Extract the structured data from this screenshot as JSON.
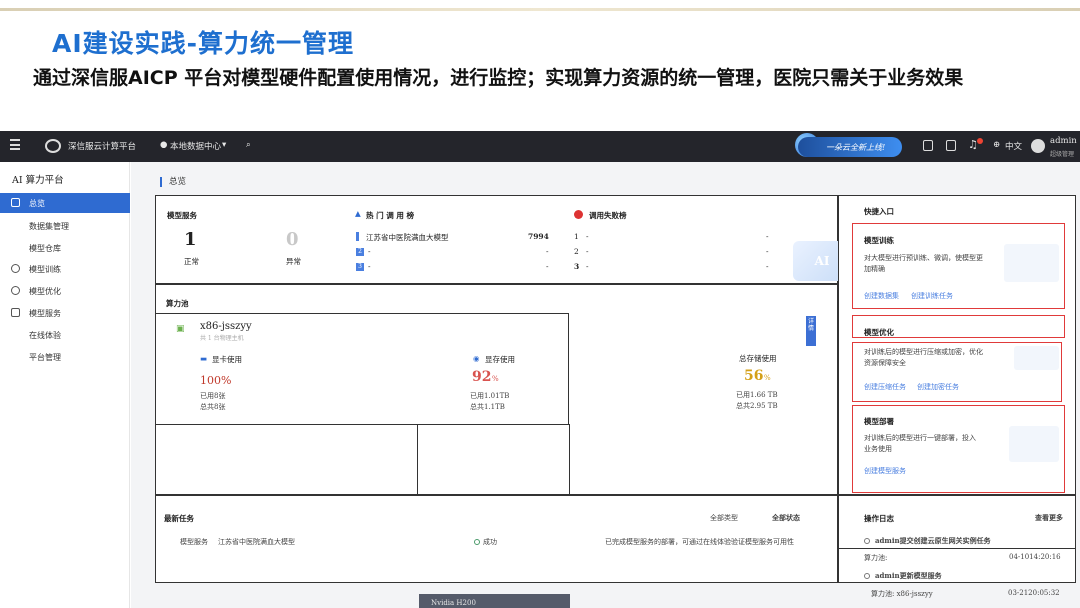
{
  "slide": {
    "title": "AI建设实践-算力统一管理",
    "description": "通过深信服AICP 平台对模型硬件配置使用情况，进行监控；实现算力资源的统一管理，医院只需关于业务效果"
  },
  "topbar": {
    "app_name": "深信服云计算平台",
    "datacenter": "本地数据中心",
    "banner_text": "一朵云全新上线!",
    "language": "中文",
    "user": "admin",
    "user_sub": "超级管理"
  },
  "sidebar": {
    "title": "AI 算力平台",
    "items": [
      {
        "label": "总览",
        "icon": "dashboard-icon"
      },
      {
        "label": "数据集管理",
        "icon": ""
      },
      {
        "label": "模型仓库",
        "icon": ""
      },
      {
        "label": "模型训练",
        "icon": "training-icon"
      },
      {
        "label": "模型优化",
        "icon": "optimize-icon"
      },
      {
        "label": "模型服务",
        "icon": "service-icon"
      },
      {
        "label": "在线体验",
        "icon": ""
      },
      {
        "label": "平台管理",
        "icon": ""
      }
    ]
  },
  "breadcrumb": "总览",
  "model_service": {
    "title": "模型服务",
    "normal_count": "1",
    "normal_label": "正常",
    "abnormal_count": "0",
    "abnormal_label": "异常"
  },
  "hot_rank": {
    "title": "热 门 调 用 榜",
    "rows": [
      {
        "rank": "",
        "name": "江苏省中医院满血大模型",
        "value": "7994"
      },
      {
        "rank": "2",
        "name": "-",
        "value": "-"
      },
      {
        "rank": "3",
        "name": "-",
        "value": "-"
      }
    ]
  },
  "fail_rank": {
    "title": "调用失败榜",
    "rows": [
      {
        "rank": "1",
        "name": "-",
        "value": "-"
      },
      {
        "rank": "2",
        "name": "-",
        "value": "-"
      },
      {
        "rank": "3",
        "name": "-",
        "value": "-"
      }
    ]
  },
  "compute_pool": {
    "title": "算力池",
    "node_name": "x86-jsszyy",
    "node_sub": "共 1 台物理主机",
    "gpu": {
      "label": "显卡使用",
      "percent": "100%",
      "used": "已用8张",
      "total": "总共8张"
    },
    "memory": {
      "label": "显存使用",
      "percent": "92",
      "unit": "%",
      "used": "已用1.01TB",
      "total": "总共1.1TB"
    },
    "storage": {
      "label": "总存储使用",
      "percent": "56",
      "unit": "%",
      "used": "已用1.66 TB",
      "total": "总共2.95 TB"
    },
    "side_tab": "详情",
    "gpu_model": "Nvidia H200"
  },
  "quick_entry": {
    "title": "快捷入口",
    "cards": [
      {
        "title": "模型训练",
        "desc": "对大模型进行预训练、微调，使模型更加精确",
        "links": [
          "创建数据集",
          "创建训练任务"
        ]
      },
      {
        "title": "模型优化",
        "desc": "对训练后的模型进行压缩或加密，优化资源保障安全",
        "links": [
          "创建压缩任务",
          "创建加密任务"
        ]
      },
      {
        "title": "模型部署",
        "desc": "对训练后的模型进行一键部署，投入业务使用",
        "links": [
          "创建模型服务"
        ]
      }
    ]
  },
  "latest_tasks": {
    "title": "最新任务",
    "filter_type": "全部类型",
    "filter_status": "全部状态",
    "rows": [
      {
        "type": "模型服务",
        "name": "江苏省中医院满血大模型",
        "status": "成功",
        "desc": "已完成模型服务的部署，可通过在线体验验证模型服务可用性"
      }
    ]
  },
  "op_log": {
    "title": "操作日志",
    "more": "查看更多",
    "entries": [
      {
        "text": "admin提交创建云原生网关实例任务",
        "pool_label": "算力池:",
        "time": "04-1014:20:16"
      },
      {
        "text": "admin更新模型服务",
        "pool_label": "算力池: x86-jsszyy",
        "time": "03-2120:05:32"
      }
    ]
  }
}
